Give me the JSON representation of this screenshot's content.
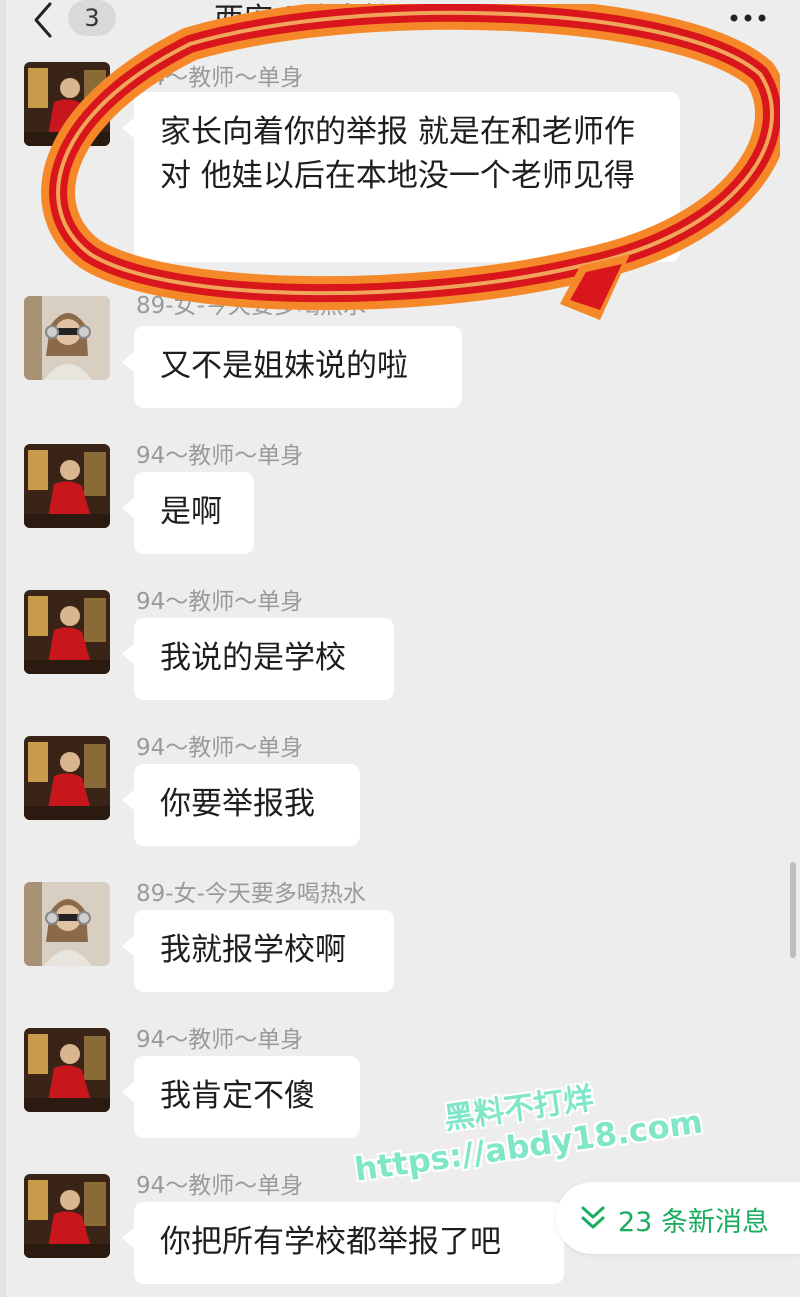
{
  "header": {
    "unread_count": "3",
    "title": "西安 | 咯卡挫"
  },
  "messages": [
    {
      "sender": "94～教师～单身",
      "text": "家长向着你的举报 就是在和老师作对 他娃以后在本地没一个老师见得"
    },
    {
      "sender": "89-女-今天要多喝热水",
      "text": "又不是姐妹说的啦"
    },
    {
      "sender": "94～教师～单身",
      "text": "是啊"
    },
    {
      "sender": "94～教师～单身",
      "text": "我说的是学校"
    },
    {
      "sender": "94～教师～单身",
      "text": "你要举报我"
    },
    {
      "sender": "89-女-今天要多喝热水",
      "text": "我就报学校啊"
    },
    {
      "sender": "94～教师～单身",
      "text": "我肯定不傻"
    },
    {
      "sender": "94～教师～单身",
      "text": "你把所有学校都举报了吧"
    }
  ],
  "new_messages": {
    "label": "23 条新消息"
  },
  "watermark": {
    "line1": "黑料不打烊",
    "line2": "https://abdy18.com"
  },
  "colors": {
    "accent_green": "#1aad5f",
    "annotation_red": "#d8161b",
    "annotation_orange": "#f5892a",
    "watermark_teal": "#7fe6c8"
  },
  "icons": {
    "back": "chevron-left-icon",
    "more": "more-icon",
    "new_messages": "chevrons-down-icon"
  }
}
